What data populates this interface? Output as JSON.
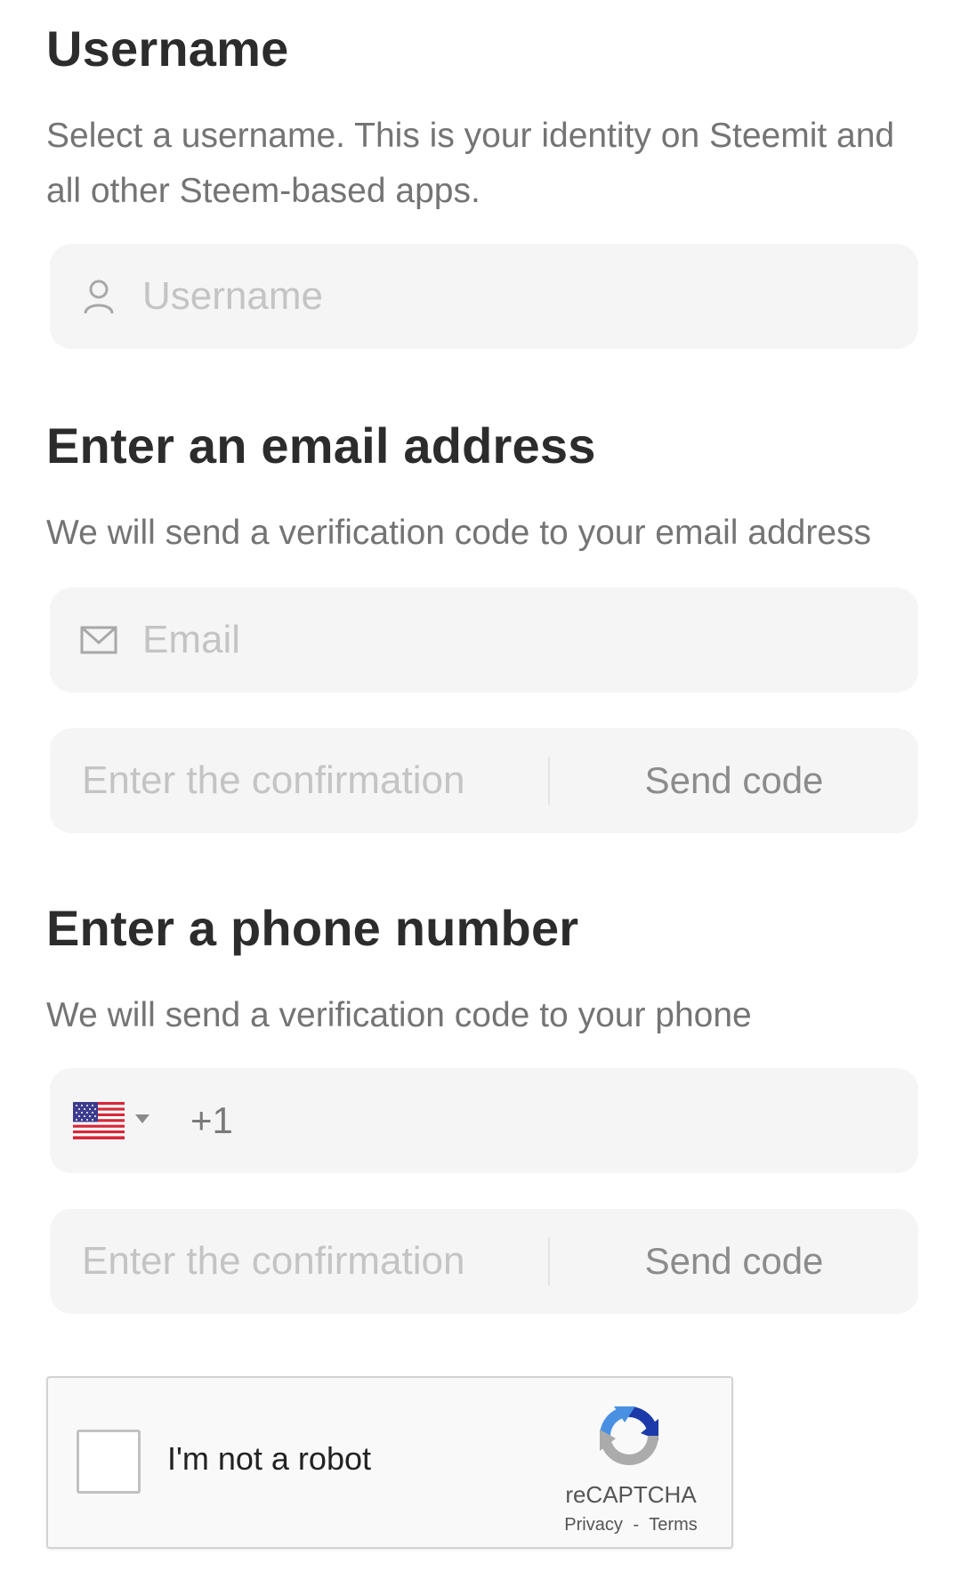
{
  "username": {
    "heading": "Username",
    "description": "Select a username. This is your identity on Steemit and all other Steem-based apps.",
    "input_placeholder": "Username",
    "icon": "user-icon"
  },
  "email": {
    "heading": "Enter an email address",
    "description": "We will send a verification code to your email address",
    "input_placeholder": "Email",
    "icon": "mail-icon",
    "code_placeholder": "Enter the confirmation",
    "send_code_label": "Send code"
  },
  "phone": {
    "heading": "Enter a phone number",
    "description": "We will send a verification code to your phone",
    "country_flag": "us-flag-icon",
    "dial_code": "+1",
    "code_placeholder": "Enter the confirmation",
    "send_code_label": "Send code"
  },
  "captcha": {
    "label": "I'm not a robot",
    "brand": "reCAPTCHA",
    "privacy": "Privacy",
    "separator": "-",
    "terms": "Terms"
  },
  "colors": {
    "field_bg": "#f5f5f5",
    "heading": "#2c2c2c",
    "description": "#747474",
    "placeholder": "#c4c4c4"
  }
}
